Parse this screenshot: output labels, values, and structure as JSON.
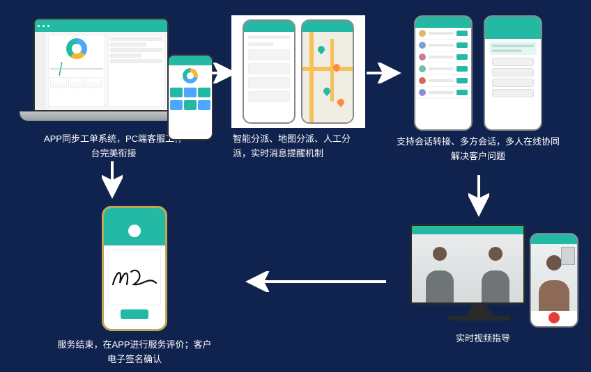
{
  "nodes": {
    "n1": {
      "caption": "APP同步工单系统，PC端客服工作台完美衔接"
    },
    "n2": {
      "caption": "智能分派、地图分派、人工分派，实时消息提醒机制"
    },
    "n3": {
      "caption": "支持会话转接、多方会话，多人在线协同解决客户问题"
    },
    "n4": {
      "caption": "实时视频指导"
    },
    "n5": {
      "caption": "服务结束，在APP进行服务评价；客户电子签名确认"
    }
  },
  "colors": {
    "bg": "#10224e",
    "accent": "#24b9a4"
  }
}
